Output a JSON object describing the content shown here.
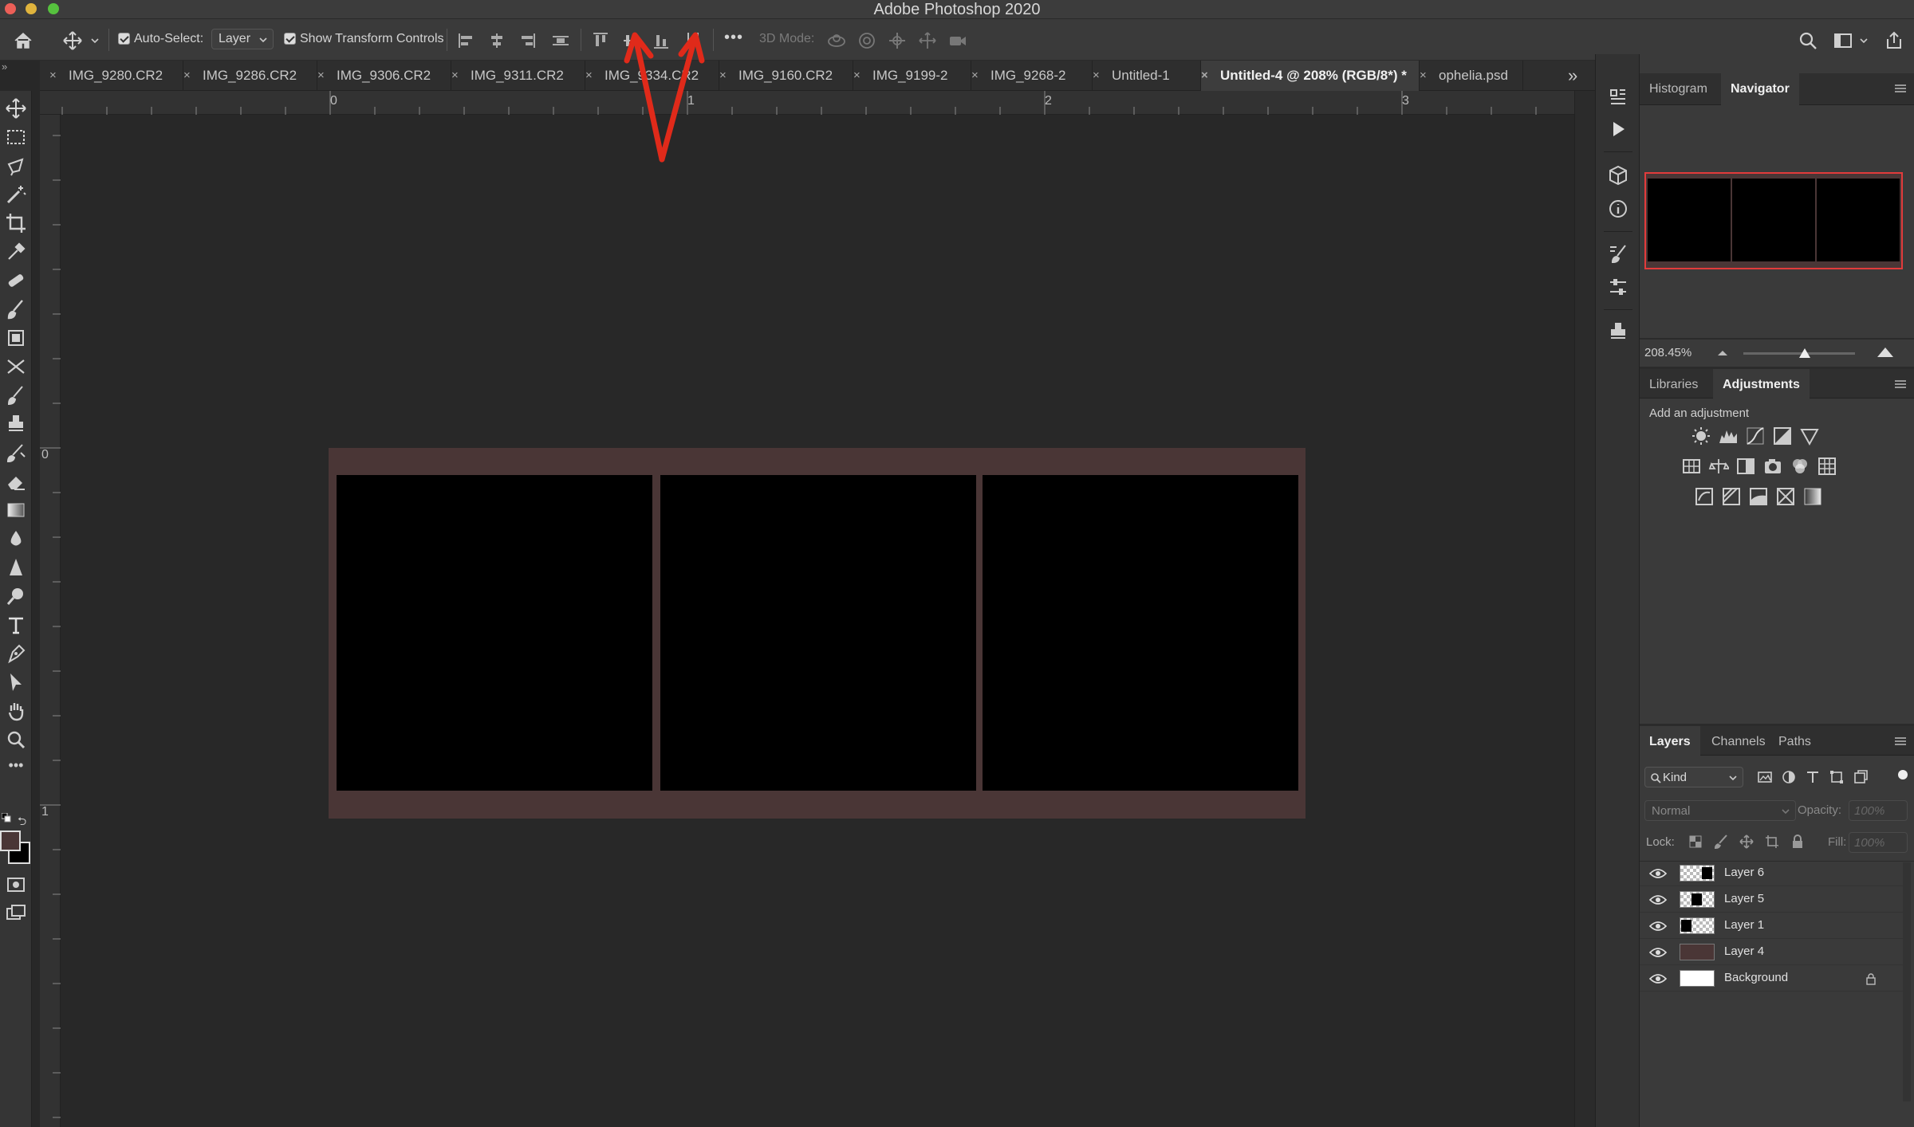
{
  "window": {
    "title": "Adobe Photoshop 2020"
  },
  "options_bar": {
    "auto_select_label": "Auto-Select:",
    "auto_select_value": "Layer",
    "show_transform_label": "Show Transform Controls",
    "mode_3d_label": "3D Mode:",
    "more_glyph": "•••"
  },
  "tabs": [
    {
      "label": "IMG_9280.CR2"
    },
    {
      "label": "IMG_9286.CR2"
    },
    {
      "label": "IMG_9306.CR2"
    },
    {
      "label": "IMG_9311.CR2"
    },
    {
      "label": "IMG_9334.CR2"
    },
    {
      "label": "IMG_9160.CR2"
    },
    {
      "label": "IMG_9199-2"
    },
    {
      "label": "IMG_9268-2"
    },
    {
      "label": "Untitled-1"
    },
    {
      "label": "Untitled-4 @ 208% (RGB/8*) *",
      "active": true
    },
    {
      "label": "ophelia.psd"
    }
  ],
  "tab_close_glyph": "×",
  "tab_overflow_glyph": "»",
  "rulers": {
    "top": [
      "0",
      "1",
      "2",
      "3"
    ],
    "left": [
      "0",
      "1"
    ]
  },
  "colors": {
    "document_background": "#4a3636",
    "frames": "#000000",
    "annotation_arrow": "#e02a1a",
    "foreground_swatch": "#4a3636",
    "background_swatch": "#000000"
  },
  "navigator": {
    "tabs": [
      "Histogram",
      "Navigator"
    ],
    "active_tab": "Navigator",
    "zoom": "208.45%",
    "zoom_slider_fraction": 0.55
  },
  "adjustments": {
    "tabs": [
      "Libraries",
      "Adjustments"
    ],
    "active_tab": "Adjustments",
    "heading": "Add an adjustment"
  },
  "layers_panel": {
    "tabs": [
      "Layers",
      "Channels",
      "Paths"
    ],
    "active_tab": "Layers",
    "filter_kind": "Kind",
    "blend_mode": "Normal",
    "opacity_label": "Opacity:",
    "opacity_value": "100%",
    "lock_label": "Lock:",
    "fill_label": "Fill:",
    "fill_value": "100%",
    "layers": [
      {
        "name": "Layer 6",
        "thumb": "checker-right-black"
      },
      {
        "name": "Layer 5",
        "thumb": "checker-center-black"
      },
      {
        "name": "Layer 1",
        "thumb": "checker-left-black"
      },
      {
        "name": "Layer 4",
        "thumb": "solid-brown"
      },
      {
        "name": "Background",
        "thumb": "solid-white",
        "locked": true
      }
    ]
  }
}
